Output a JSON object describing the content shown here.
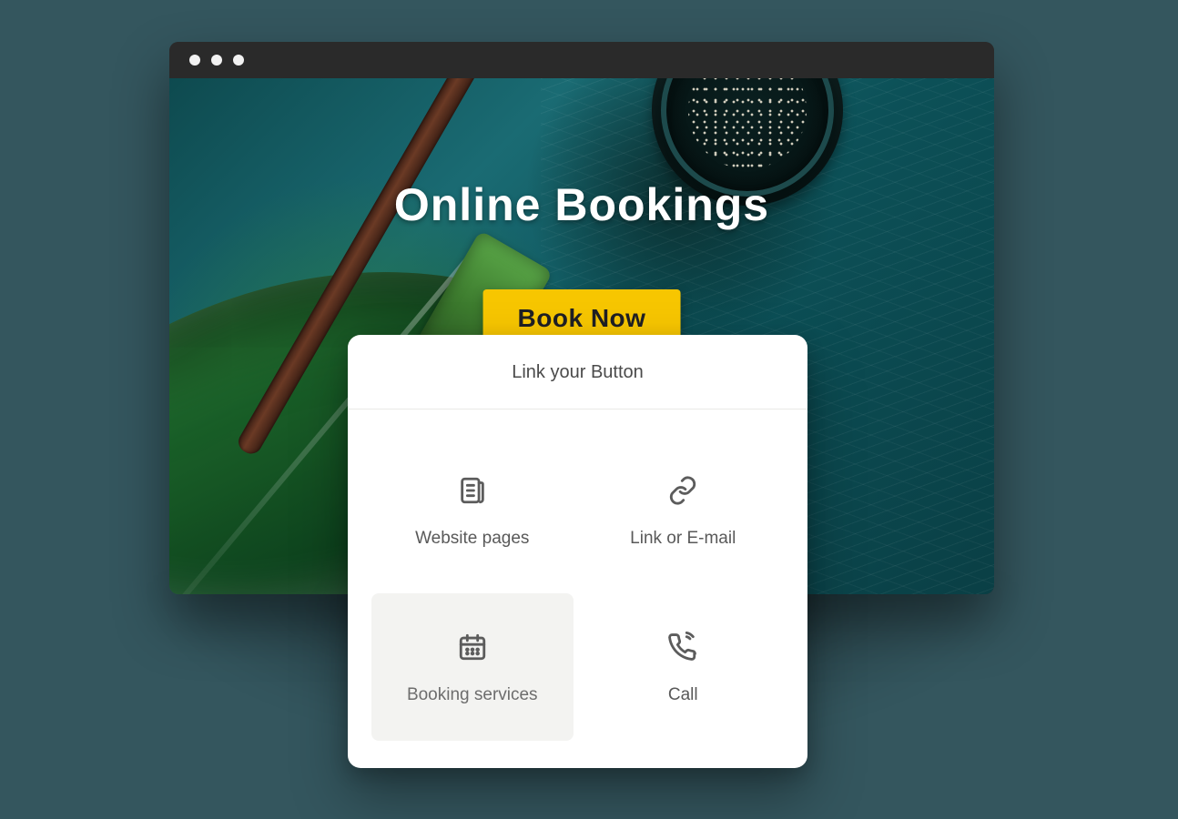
{
  "hero": {
    "title": "Online Bookings",
    "cta_label": "Book Now"
  },
  "popover": {
    "title": "Link your Button",
    "options": [
      {
        "label": "Website pages",
        "icon": "pages-icon",
        "selected": false
      },
      {
        "label": "Link or E-mail",
        "icon": "link-icon",
        "selected": false
      },
      {
        "label": "Booking services",
        "icon": "calendar-icon",
        "selected": true
      },
      {
        "label": "Call",
        "icon": "phone-icon",
        "selected": false
      }
    ]
  },
  "colors": {
    "accent": "#f7c600",
    "background": "#34565e",
    "titlebar": "#2a2a2a",
    "text_dark": "#1f1f24",
    "text_muted": "#595959"
  }
}
